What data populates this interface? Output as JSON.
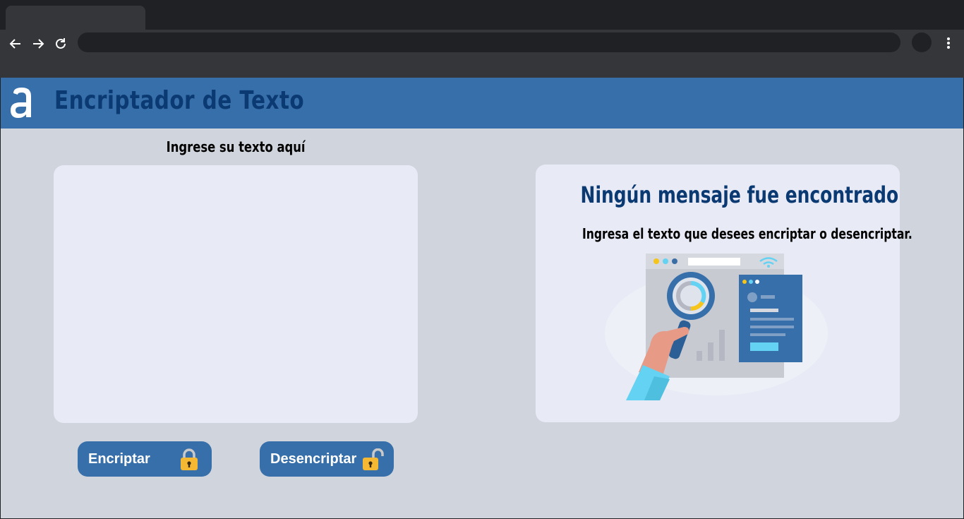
{
  "app": {
    "title": "Encriptador de Texto"
  },
  "input": {
    "label": "Ingrese su texto aquí",
    "value": "",
    "placeholder": ""
  },
  "buttons": {
    "encrypt_label": "Encriptar",
    "decrypt_label": "Desencriptar"
  },
  "output": {
    "title": "Ningún mensaje fue encontrado",
    "subtitle": "Ingresa el texto que desees encriptar o desencriptar."
  },
  "colors": {
    "header": "#366fa9",
    "title_text": "#0b3a73",
    "page_bg": "#d0d4dc",
    "card_bg": "#e8eaf5",
    "lock": "#f4b833"
  },
  "icons": {
    "logo": "alura-a-logo",
    "encrypt": "locked-padlock-icon",
    "decrypt": "unlocked-padlock-icon",
    "illustration": "magnifying-glass-search-illustration"
  }
}
